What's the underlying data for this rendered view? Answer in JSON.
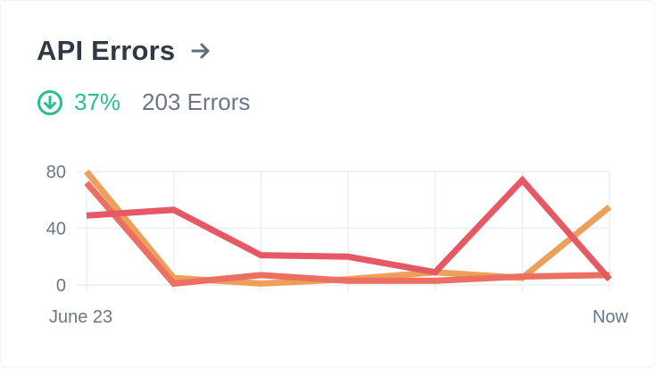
{
  "header": {
    "title": "API Errors",
    "link_icon": "arrow-right-icon"
  },
  "stats": {
    "trend_icon": "arrow-down-circle-icon",
    "change_percent": "37%",
    "error_count": "203 Errors",
    "trend_color": "#29c08d"
  },
  "chart_data": {
    "type": "line",
    "x": [
      "June 23",
      "",
      "",
      "",
      "",
      "",
      "Now"
    ],
    "x_tick_labels": [
      "June 23",
      "Now"
    ],
    "y_ticks": [
      0,
      40,
      80
    ],
    "ylim": [
      0,
      80
    ],
    "grid": true,
    "series": [
      {
        "color": "#eda05a",
        "values": [
          80,
          5,
          1,
          4,
          9,
          5,
          55
        ]
      },
      {
        "color": "#ec7062",
        "values": [
          72,
          1,
          7,
          3,
          3,
          6,
          7
        ]
      },
      {
        "color": "#e55864",
        "values": [
          49,
          53,
          21,
          20,
          9,
          74,
          4
        ]
      }
    ]
  }
}
